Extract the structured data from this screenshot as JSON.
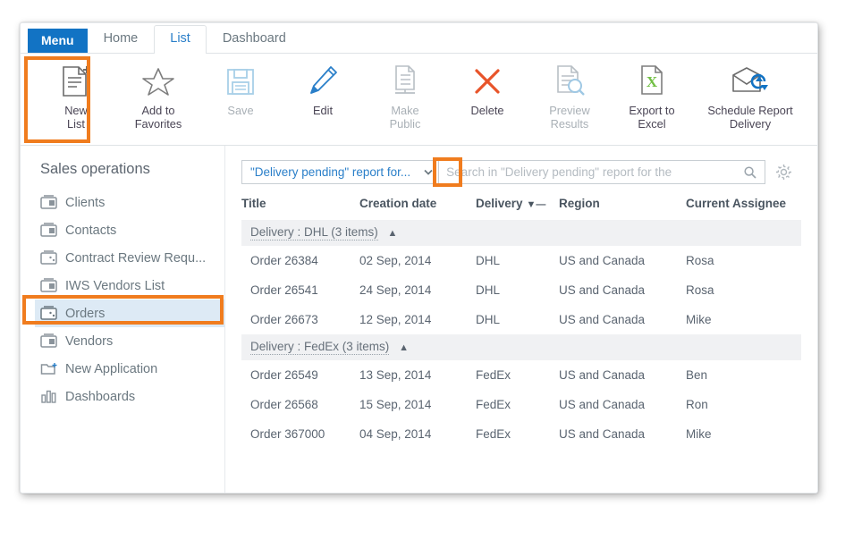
{
  "tabs": [
    {
      "label": "Menu",
      "type": "menu"
    },
    {
      "label": "Home",
      "type": "tab",
      "active": false
    },
    {
      "label": "List",
      "type": "tab",
      "active": true
    },
    {
      "label": "Dashboard",
      "type": "tab",
      "active": false
    }
  ],
  "toolbar": {
    "items": [
      {
        "label": "New\nList",
        "label_l1": "New",
        "label_l2": "List",
        "icon": "new-list-icon",
        "disabled": false,
        "annotated": true
      },
      {
        "label": "Add to Favorites",
        "label_l1": "Add to",
        "label_l2": "Favorites",
        "icon": "star-icon",
        "disabled": false,
        "annotated": false
      },
      {
        "label": "Save",
        "label_l1": "Save",
        "label_l2": "",
        "icon": "save-icon",
        "disabled": true,
        "annotated": false
      },
      {
        "label": "Edit",
        "label_l1": "Edit",
        "label_l2": "",
        "icon": "edit-pencil-icon",
        "disabled": false,
        "annotated": false
      },
      {
        "label": "Make Public",
        "label_l1": "Make",
        "label_l2": "Public",
        "icon": "make-public-icon",
        "disabled": true,
        "annotated": false
      },
      {
        "label": "Delete",
        "label_l1": "Delete",
        "label_l2": "",
        "icon": "delete-x-icon",
        "disabled": false,
        "annotated": false
      },
      {
        "label": "Preview Results",
        "label_l1": "Preview",
        "label_l2": "Results",
        "icon": "preview-results-icon",
        "disabled": true,
        "annotated": false
      },
      {
        "label": "Export to Excel",
        "label_l1": "Export to",
        "label_l2": "Excel",
        "icon": "export-excel-icon",
        "disabled": false,
        "annotated": false
      },
      {
        "label": "Schedule Report Delivery",
        "label_l1": "Schedule Report",
        "label_l2": "Delivery",
        "icon": "schedule-report-icon",
        "disabled": false,
        "annotated": false
      }
    ]
  },
  "sidebar": {
    "title": "Sales operations",
    "items": [
      {
        "label": "Clients",
        "icon": "list-box-icon",
        "selected": false
      },
      {
        "label": "Contacts",
        "icon": "list-box-icon",
        "selected": false
      },
      {
        "label": "Contract Review Requ...",
        "icon": "list-box-icon",
        "selected": false
      },
      {
        "label": "IWS Vendors List",
        "icon": "list-box-icon",
        "selected": false
      },
      {
        "label": "Orders",
        "icon": "list-box-icon",
        "selected": true
      },
      {
        "label": "Vendors",
        "icon": "list-box-icon",
        "selected": false
      },
      {
        "label": "New Application",
        "icon": "new-folder-icon",
        "selected": false
      },
      {
        "label": "Dashboards",
        "icon": "bar-chart-icon",
        "selected": false
      }
    ]
  },
  "search": {
    "report_name": "\"Delivery pending\" report for...",
    "placeholder": "Search in \"Delivery pending\" report for the",
    "value": "",
    "dropdown_icon": "chevron-down-icon",
    "search_icon": "search-icon",
    "settings_icon": "gear-icon"
  },
  "table": {
    "columns": [
      {
        "label": "Title",
        "key": "title"
      },
      {
        "label": "Creation date",
        "key": "date"
      },
      {
        "label": "Delivery",
        "key": "delivery",
        "filtered": true
      },
      {
        "label": "Region",
        "key": "region"
      },
      {
        "label": "Current Assignee",
        "key": "assignee"
      }
    ],
    "groups": [
      {
        "label": "Delivery : DHL (3 items)",
        "expanded": true,
        "rows": [
          {
            "title": "Order 26384",
            "date": "02 Sep, 2014",
            "delivery": "DHL",
            "region": "US and Canada",
            "assignee": "Rosa"
          },
          {
            "title": "Order 26541",
            "date": "24 Sep, 2014",
            "delivery": "DHL",
            "region": "US and Canada",
            "assignee": "Rosa"
          },
          {
            "title": "Order 26673",
            "date": "12 Sep, 2014",
            "delivery": "DHL",
            "region": "US and Canada",
            "assignee": "Mike"
          }
        ]
      },
      {
        "label": "Delivery : FedEx (3 items)",
        "expanded": true,
        "rows": [
          {
            "title": "Order 26549",
            "date": "13 Sep, 2014",
            "delivery": "FedEx",
            "region": "US and Canada",
            "assignee": "Ben"
          },
          {
            "title": "Order 26568",
            "date": "15 Sep, 2014",
            "delivery": "FedEx",
            "region": "US and Canada",
            "assignee": "Ron"
          },
          {
            "title": "Order 367000",
            "date": "04 Sep, 2014",
            "delivery": "FedEx",
            "region": "US and Canada",
            "assignee": "Mike"
          }
        ]
      }
    ]
  },
  "colors": {
    "accent_blue": "#1273c4",
    "link_blue": "#2a7fc9",
    "annotation_orange": "#f07c1e",
    "selected_row": "#ddeaf5",
    "group_header_bg": "#f0f1f3",
    "excel_green": "#72bf44",
    "delete_red": "#e8542a"
  }
}
